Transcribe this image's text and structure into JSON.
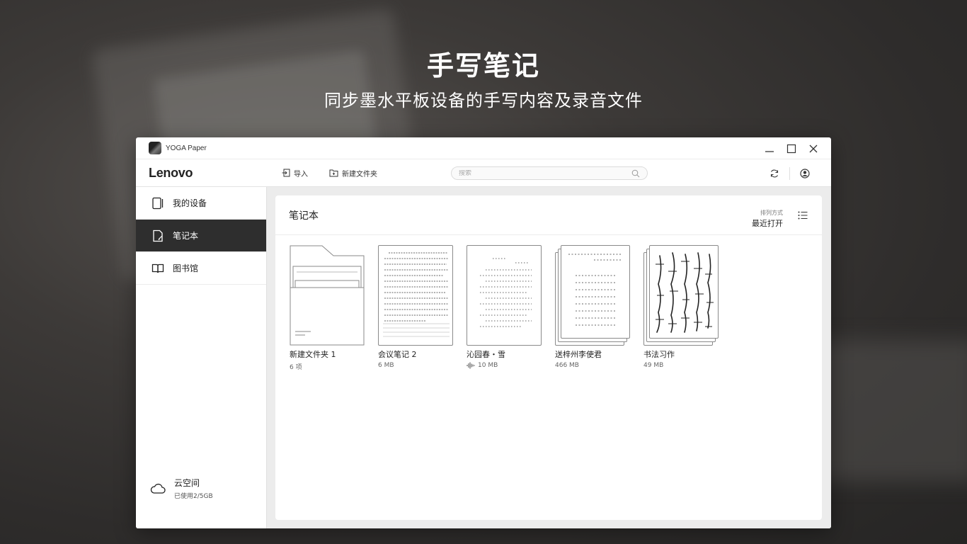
{
  "hero": {
    "title": "手写笔记",
    "subtitle": "同步墨水平板设备的手写内容及录音文件"
  },
  "window": {
    "app_title": "YOGA Paper",
    "controls": [
      "minimize-icon",
      "maximize-icon",
      "close-icon"
    ]
  },
  "toolbar": {
    "brand": "Lenovo",
    "import_label": "导入",
    "new_folder_label": "新建文件夹",
    "search_placeholder": "搜索",
    "icons": [
      "sync-icon",
      "user-avatar-icon"
    ]
  },
  "sidebar": {
    "items": [
      {
        "label": "我的设备",
        "icon": "tablet-icon",
        "active": false
      },
      {
        "label": "笔记本",
        "icon": "notebook-icon",
        "active": true
      },
      {
        "label": "图书馆",
        "icon": "book-open-icon",
        "active": false
      }
    ],
    "cloud": {
      "title": "云空间",
      "usage": "已使用2/5GB",
      "icon": "cloud-icon"
    }
  },
  "main": {
    "title": "笔记本",
    "sort_label": "排列方式",
    "sort_value": "最近打开",
    "items": [
      {
        "name": "新建文件夹 1",
        "meta": "6 项",
        "kind": "folder"
      },
      {
        "name": "会议笔记 2",
        "meta": "6 MB",
        "kind": "lined-note"
      },
      {
        "name": "沁园春・雪",
        "meta": "10 MB",
        "kind": "poem-note",
        "has_audio": true
      },
      {
        "name": "送梓州李使君",
        "meta": "466 MB",
        "kind": "stacked-note"
      },
      {
        "name": "书法习作",
        "meta": "49 MB",
        "kind": "calligraphy-note"
      }
    ]
  },
  "colors": {
    "accent_dark": "#2e2e2e",
    "panel_bg": "#ececec"
  }
}
